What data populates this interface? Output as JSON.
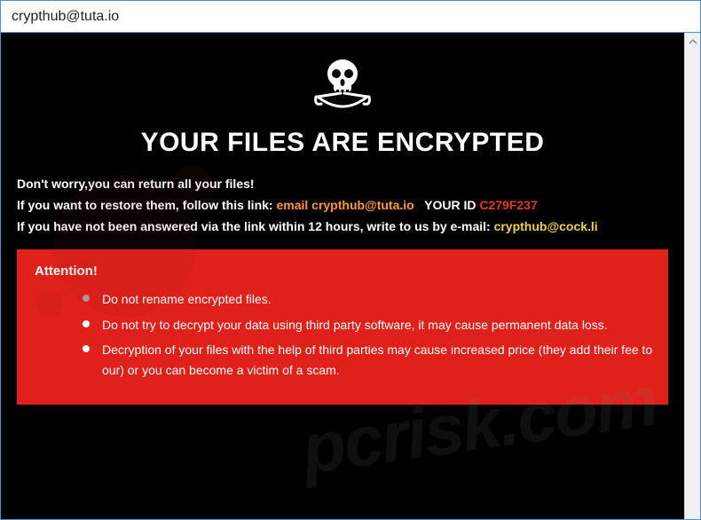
{
  "titlebar": {
    "title": "crypthub@tuta.io"
  },
  "hero": {
    "icon": "skull-swords-icon",
    "headline": "YOUR FILES ARE ENCRYPTED"
  },
  "intro": {
    "line1": "Don't worry,you can return all your files!",
    "line2_prefix": "If you want to restore them, follow this link: ",
    "line2_email_label": "email crypthub@tuta.io",
    "line2_id_label": "   YOUR ID ",
    "line2_id_value": "C279F237",
    "line3_prefix": "If you have not been answered via the link within 12 hours, write to us by e-mail: ",
    "line3_email": "crypthub@cock.li"
  },
  "attention": {
    "title": "Attention!",
    "items": [
      "Do not rename encrypted files.",
      "Do not try to decrypt your data using third party software, it may cause permanent data loss.",
      "Decryption of your files with the help of third parties may cause increased price (they add their fee to our) or you can become a victim of a scam."
    ]
  },
  "watermark": {
    "text": "pcrisk.com"
  }
}
